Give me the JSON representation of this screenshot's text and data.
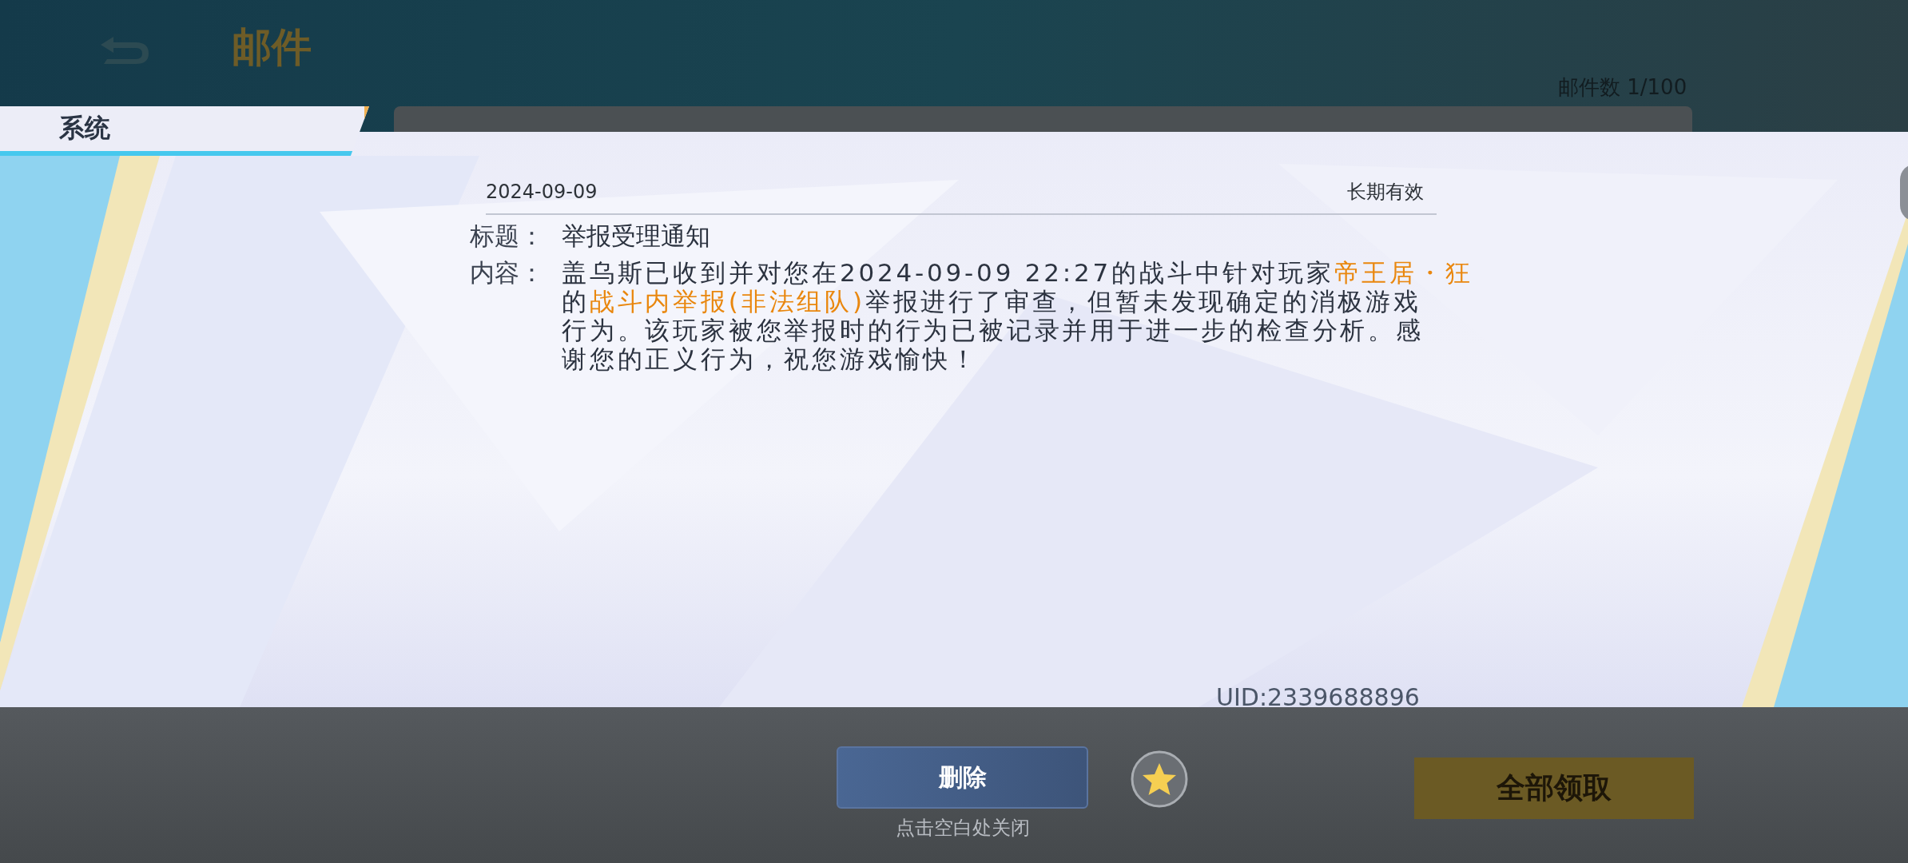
{
  "header": {
    "title": "邮件",
    "mail_count": "邮件数 1/100"
  },
  "tabs": [
    {
      "label": "系统",
      "selected": true
    }
  ],
  "mail": {
    "date": "2024-09-09",
    "validity": "长期有效",
    "title_label": "标题：",
    "title": "举报受理通知",
    "content_label": "内容：",
    "content_lines": [
      [
        {
          "text": "盖乌斯已收到并对您在2024-09-09 22:27的战斗中针对玩家",
          "highlight": false
        },
        {
          "text": "帝王居・狂",
          "highlight": true
        }
      ],
      [
        {
          "text": "的",
          "highlight": false
        },
        {
          "text": "战斗内举报(非法组队)",
          "highlight": true
        },
        {
          "text": "举报进行了审查，但暂未发现确定的消极游戏",
          "highlight": false
        }
      ],
      [
        {
          "text": "行为。该玩家被您举报时的行为已被记录并用于进一步的检查分析。感",
          "highlight": false
        }
      ],
      [
        {
          "text": "谢您的正义行为，祝您游戏愉快！",
          "highlight": false
        }
      ]
    ],
    "uid": "UID:2339688896"
  },
  "footer": {
    "delete_button": "删除",
    "hint": "点击空白处关闭",
    "claim_all_button": {
      "label": "全部领取",
      "disabled": true
    }
  }
}
